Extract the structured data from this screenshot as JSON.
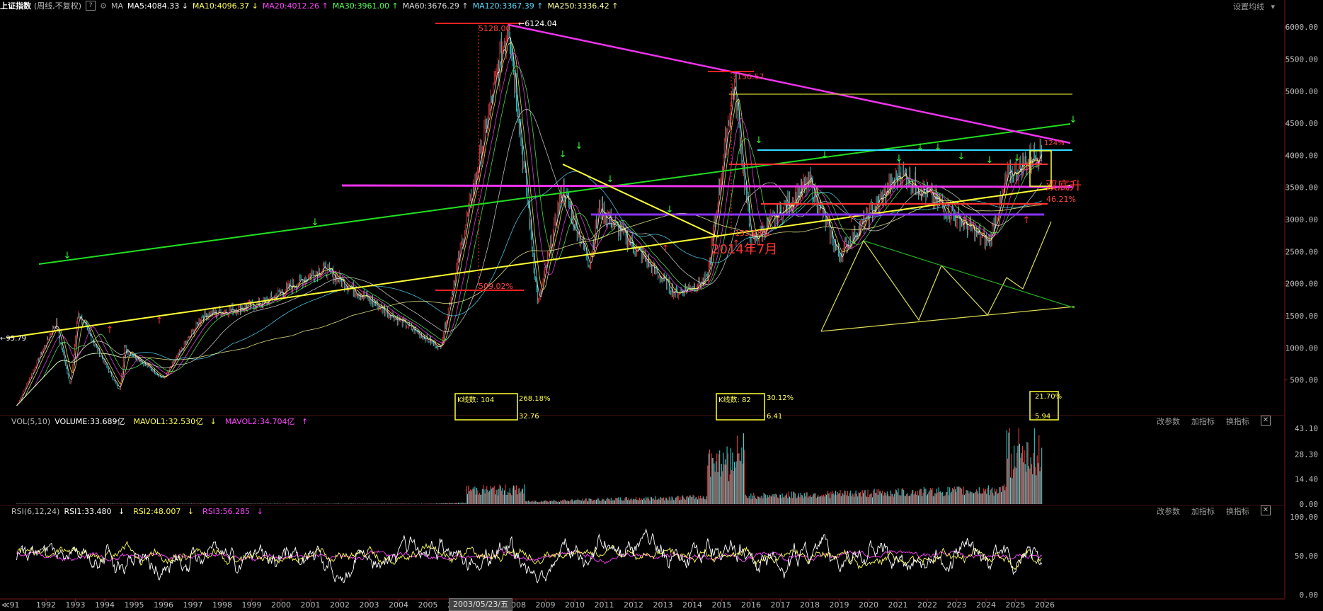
{
  "header": {
    "title": "上证指数",
    "subtitle": "(周线,不复权)",
    "help": "?",
    "ma_label": "MA",
    "ma": [
      {
        "label": "MA5:4084.33",
        "arrow": "↓",
        "color": "#ffffff"
      },
      {
        "label": "MA10:4096.37",
        "arrow": "↓",
        "color": "#ffff55"
      },
      {
        "label": "MA20:4012.26",
        "arrow": "↑",
        "color": "#ff44ff"
      },
      {
        "label": "MA30:3961.00",
        "arrow": "↑",
        "color": "#55ff55"
      },
      {
        "label": "MA60:3676.29",
        "arrow": "↑",
        "color": "#dddddd"
      },
      {
        "label": "MA120:3367.39",
        "arrow": "↑",
        "color": "#55ddff"
      },
      {
        "label": "MA250:3336.42",
        "arrow": "↑",
        "color": "#ffff99"
      }
    ],
    "settings": "设置均线"
  },
  "price_axis": [
    "6000.00",
    "5500.00",
    "5000.00",
    "4500.00",
    "4000.00",
    "3500.00",
    "3000.00",
    "2500.00",
    "2000.00",
    "1500.00",
    "1000.00",
    "500.00"
  ],
  "annotations": {
    "peak_label": "6124.04",
    "peak_level": "5128.00",
    "peak2_level": "3156.57",
    "low_pct": "509.02%",
    "mid_pct": "155.28%",
    "date_note": "2014年7月",
    "start_label": "95.79",
    "pct_right": "46.21%",
    "right_small": "124%",
    "double_bottom": "双底升"
  },
  "volume": {
    "label": "VOL(5,10)",
    "volume": "VOLUME:33.689亿",
    "mavol1": "MAVOL1:32.530亿",
    "mavol2": "MAVOL2:34.704亿",
    "arrow1": "↓",
    "arrow2": "↑",
    "axis": [
      "43.10",
      "28.30",
      "14.40",
      "0.00"
    ],
    "box1_label": "K线数: 104",
    "box1_pct": "268.18%",
    "box1_low": "32.76",
    "box2_label": "K线数: 82",
    "box2_pct": "30.12%",
    "box2_low": "6.41",
    "box3_pct": "21.70%",
    "box3_low": "5.94",
    "btn_params": "改参数",
    "btn_add": "加指标",
    "btn_switch": "换指标",
    "close": "✕"
  },
  "rsi": {
    "label": "RSI(6,12,24)",
    "rsi1": "RSI1:33.480",
    "rsi2": "RSI2:48.007",
    "rsi3": "RSI3:56.285",
    "arrow1": "↓",
    "arrow2": "↓",
    "arrow3": "↓",
    "axis": [
      "100.00",
      "50.00",
      "0.00"
    ],
    "btn_params": "改参数",
    "btn_add": "加指标",
    "btn_switch": "换指标",
    "close": "✕"
  },
  "time_axis": {
    "left_mark": "≪91",
    "years": [
      "1992",
      "1993",
      "1994",
      "1995",
      "1996",
      "1997",
      "1998",
      "1999",
      "2000",
      "2001",
      "2002",
      "2003",
      "2004",
      "2005",
      "2006",
      "2007",
      "2008",
      "2009",
      "2010",
      "2011",
      "2012",
      "2013",
      "2014",
      "2015",
      "2016",
      "2017",
      "2018",
      "2019",
      "2020",
      "2021",
      "2022",
      "2023",
      "2024",
      "2025",
      "2026"
    ],
    "cursor_date": "2003/05/23/五"
  },
  "chart_data": {
    "type": "candlestick",
    "weekly_close_approx": [
      {
        "x": "1991",
        "y": 100
      },
      {
        "x": "1992-05",
        "y": 1400
      },
      {
        "x": "1992-11",
        "y": 400
      },
      {
        "x": "1993-02",
        "y": 1550
      },
      {
        "x": "1994-07",
        "y": 330
      },
      {
        "x": "1994-09",
        "y": 1000
      },
      {
        "x": "1996-01",
        "y": 520
      },
      {
        "x": "1997-05",
        "y": 1500
      },
      {
        "x": "1999-06",
        "y": 1700
      },
      {
        "x": "2001-06",
        "y": 2245
      },
      {
        "x": "2005-06",
        "y": 1000
      },
      {
        "x": "2007-10",
        "y": 6124
      },
      {
        "x": "2008-10",
        "y": 1664
      },
      {
        "x": "2009-08",
        "y": 3478
      },
      {
        "x": "2010-07",
        "y": 2320
      },
      {
        "x": "2010-11",
        "y": 3186
      },
      {
        "x": "2013-06",
        "y": 1850
      },
      {
        "x": "2014-07",
        "y": 2050
      },
      {
        "x": "2015-06",
        "y": 5178
      },
      {
        "x": "2016-01",
        "y": 2638
      },
      {
        "x": "2018-01",
        "y": 3587
      },
      {
        "x": "2019-01",
        "y": 2440
      },
      {
        "x": "2021-02",
        "y": 3731
      },
      {
        "x": "2024-02",
        "y": 2635
      },
      {
        "x": "2024-10",
        "y": 3674
      },
      {
        "x": "2025-12",
        "y": 4084
      }
    ],
    "ylim": [
      0,
      6200
    ],
    "volume_ylim": [
      0,
      43.1
    ],
    "rsi_ylim": [
      0,
      100
    ]
  }
}
